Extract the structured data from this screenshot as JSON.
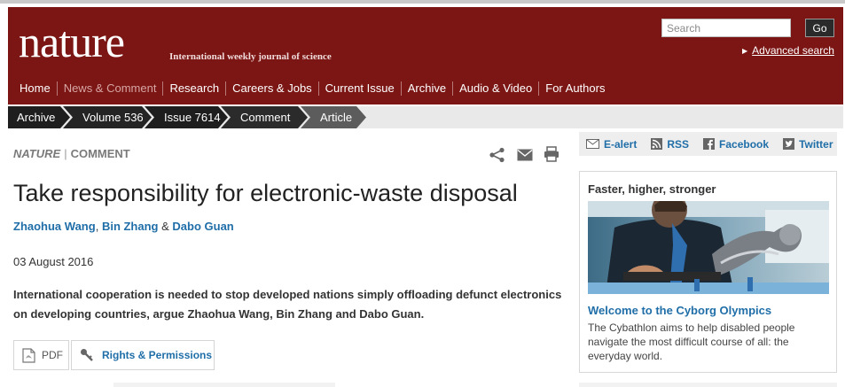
{
  "header": {
    "logo": "nature",
    "tagline": "International weekly journal of science",
    "search_placeholder": "Search",
    "search_button": "Go",
    "advanced_search": "Advanced search",
    "brand_color": "#7b1614"
  },
  "nav": {
    "items": [
      {
        "label": "Home"
      },
      {
        "label": "News & Comment"
      },
      {
        "label": "Research"
      },
      {
        "label": "Careers & Jobs"
      },
      {
        "label": "Current Issue"
      },
      {
        "label": "Archive"
      },
      {
        "label": "Audio & Video"
      },
      {
        "label": "For Authors"
      }
    ]
  },
  "breadcrumb": {
    "items": [
      {
        "label": "Archive"
      },
      {
        "label": "Volume 536"
      },
      {
        "label": "Issue 7614"
      },
      {
        "label": "Comment"
      },
      {
        "label": "Article"
      }
    ]
  },
  "article": {
    "journal": "NATURE",
    "separator": "|",
    "section": "COMMENT",
    "title": "Take responsibility for electronic-waste disposal",
    "authors": [
      {
        "name": "Zhaohua Wang"
      },
      {
        "name": "Bin Zhang"
      },
      {
        "name": "Dabo Guan"
      }
    ],
    "author_comma": ",",
    "author_amp": "&",
    "date": "03 August 2016",
    "standfirst": "International cooperation is needed to stop developed nations simply offloading defunct electronics on developing countries, argue Zhaohua Wang, Bin Zhang and Dabo Guan.",
    "pdf_label": "PDF",
    "rights_label": "Rights & Permissions",
    "icons": [
      "share-icon",
      "mail-icon",
      "print-icon"
    ]
  },
  "sidebar": {
    "alerts": [
      {
        "label": "E-alert",
        "icon": "envelope-icon"
      },
      {
        "label": "RSS",
        "icon": "rss-icon"
      },
      {
        "label": "Facebook",
        "icon": "facebook-icon"
      },
      {
        "label": "Twitter",
        "icon": "twitter-icon"
      }
    ],
    "promo": {
      "heading": "Faster, higher, stronger",
      "link": "Welcome to the Cyborg Olympics",
      "text": "The Cybathlon aims to help disabled people navigate the most difficult course of all: the everyday world."
    }
  },
  "colors": {
    "link": "#1f6ea8",
    "breadcrumb_dark": "#1e1e1e",
    "breadcrumb_active": "#5c5c5c"
  }
}
